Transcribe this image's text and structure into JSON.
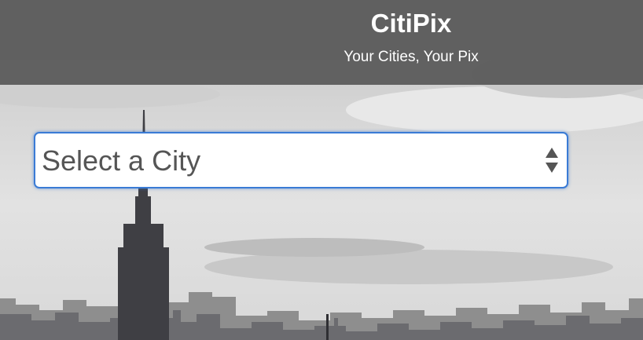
{
  "app": {
    "title": "CitiPix",
    "tagline": "Your Cities, Your Pix"
  },
  "city_select": {
    "selected": "Select a City"
  },
  "colors": {
    "header_bg": "#585858",
    "select_focus_border": "#3a7bd5",
    "skyline": "#3f3f44"
  },
  "icons": {
    "select_arrows": "up-down-arrows-icon"
  }
}
